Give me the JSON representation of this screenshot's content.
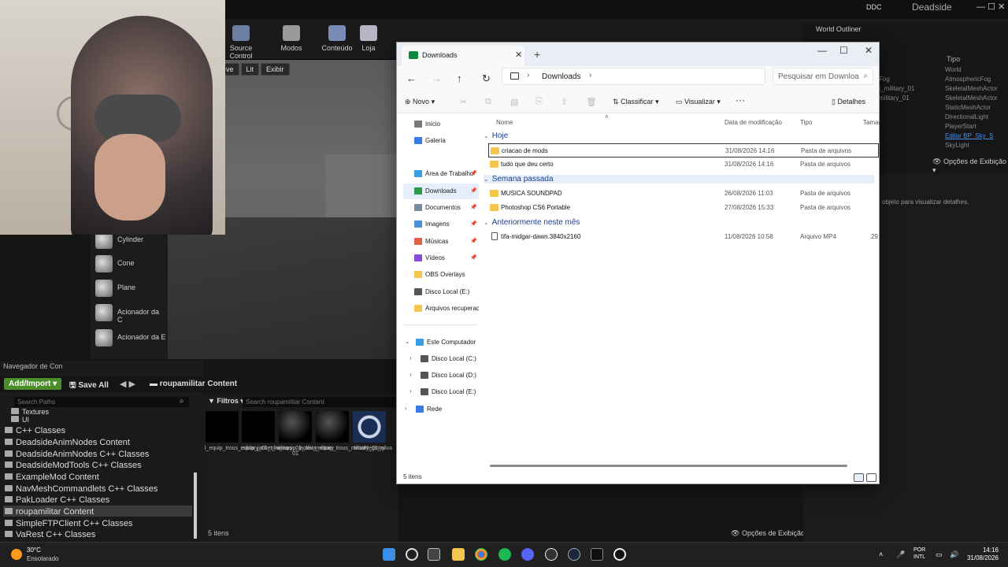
{
  "ue": {
    "top_right": {
      "ddc": "DDC",
      "project": "Deadside"
    },
    "toolbar": [
      {
        "label": "Source Control"
      },
      {
        "label": "Modos"
      },
      {
        "label": "Conteúdo"
      },
      {
        "label": "Loja"
      }
    ],
    "viewport_buttons": [
      "ve",
      "Lit",
      "Exibir"
    ],
    "place_items": [
      "Cylinder",
      "Cone",
      "Plane",
      "Acionador da C",
      "Acionador da E"
    ],
    "content_browser": {
      "tab": "Navegador de Con",
      "add_import": "Add/Import",
      "save_all": "Save All",
      "path": "roupamilitar Content",
      "search_paths": "Search Paths",
      "filters": "Filtros",
      "search_assets": "Search roupamilitar Content",
      "tree": [
        "Textures",
        "UI",
        "C++ Classes",
        "DeadsideAnimNodes Content",
        "DeadsideAnimNodes C++ Classes",
        "DeadsideModTools C++ Classes",
        "ExampleMod Content",
        "NavMeshCommandlets C++ Classes",
        "PakLoader C++ Classes",
        "roupamilitar Content",
        "SimpleFTPClient C++ Classes",
        "VaRest C++ Classes"
      ],
      "assets": [
        {
          "label": "l_equip_trous_military_01_oliva"
        },
        {
          "label": "equip_jacket_military_01_oliva"
        },
        {
          "label": "i_equip_jacket_military 01"
        },
        {
          "label": "i_equip_trous_military_01_oliva"
        },
        {
          "label": "ModRegistry"
        }
      ],
      "count": "5 itens",
      "view_options": "Opções de Exibição"
    },
    "world_outliner": {
      "tab": "World Outliner",
      "col_tipo": "Tipo",
      "types": [
        "World",
        "AtmosphericFog",
        "SkeletalMeshActor",
        "SkeletalMeshActor",
        "StaticMeshActor",
        "DirectionalLight",
        "PlayerStart",
        "Editar BP_Sky_S",
        "SkyLight"
      ],
      "names": [
        "Fog",
        "t_military_01",
        "military_01"
      ],
      "view_options": "Opções de Exibição",
      "details_msg": "objeto para visualizar detalhes."
    }
  },
  "explorer": {
    "tab_title": "Downloads",
    "address": "Downloads",
    "search_placeholder": "Pesquisar em Downloa",
    "cmd": {
      "novo": "Novo",
      "classificar": "Classificar",
      "visualizar": "Visualizar",
      "more": "···",
      "detalhes": "Detalhes"
    },
    "nav": [
      {
        "label": "Início",
        "icon": "home"
      },
      {
        "label": "Galeria",
        "icon": "gallery"
      },
      {
        "label": "Área de Trabalho",
        "icon": "desktop",
        "pin": true
      },
      {
        "label": "Downloads",
        "icon": "download",
        "pin": true,
        "selected": true
      },
      {
        "label": "Documentos",
        "icon": "docs",
        "pin": true
      },
      {
        "label": "Imagens",
        "icon": "images",
        "pin": true
      },
      {
        "label": "Músicas",
        "icon": "music",
        "pin": true
      },
      {
        "label": "Vídeos",
        "icon": "videos",
        "pin": true
      },
      {
        "label": "OBS Overlays",
        "icon": "folder"
      },
      {
        "label": "Disco Local (E:)",
        "icon": "drive"
      },
      {
        "label": "Arquivos recuperac",
        "icon": "folder"
      }
    ],
    "nav_tree": [
      {
        "label": "Este Computador"
      },
      {
        "label": "Disco Local (C:)"
      },
      {
        "label": "Disco Local (D:)"
      },
      {
        "label": "Disco Local (E:)"
      },
      {
        "label": "Rede"
      }
    ],
    "columns": {
      "name": "Nome",
      "date": "Data de modificação",
      "type": "Tipo",
      "size": "Tamar"
    },
    "groups": [
      {
        "label": "Hoje",
        "files": [
          {
            "name": "criacao de mods",
            "date": "31/08/2026 14:16",
            "type": "Pasta de arquivos",
            "size": ""
          },
          {
            "name": "tudo que deu certo",
            "date": "31/08/2026 14:16",
            "type": "Pasta de arquivos",
            "size": ""
          }
        ]
      },
      {
        "label": "Semana passada",
        "files": [
          {
            "name": "MUSICA SOUNDPAD",
            "date": "26/08/2026 11:03",
            "type": "Pasta de arquivos",
            "size": ""
          },
          {
            "name": "Photoshop CS6 Portable",
            "date": "27/08/2026 15:33",
            "type": "Pasta de arquivos",
            "size": ""
          }
        ]
      },
      {
        "label": "Anteriormente neste mês",
        "files": [
          {
            "name": "tifa-midgar-dawn.3840x2160",
            "date": "11/08/2026 10:58",
            "type": "Arquivo MP4",
            "size": "29."
          }
        ]
      }
    ],
    "status": "5 itens"
  },
  "taskbar": {
    "weather": {
      "temp": "30°C",
      "cond": "Ensolarado"
    },
    "lang1": "POR",
    "lang2": "INTL",
    "time": "14:16",
    "date": "31/08/2026"
  }
}
